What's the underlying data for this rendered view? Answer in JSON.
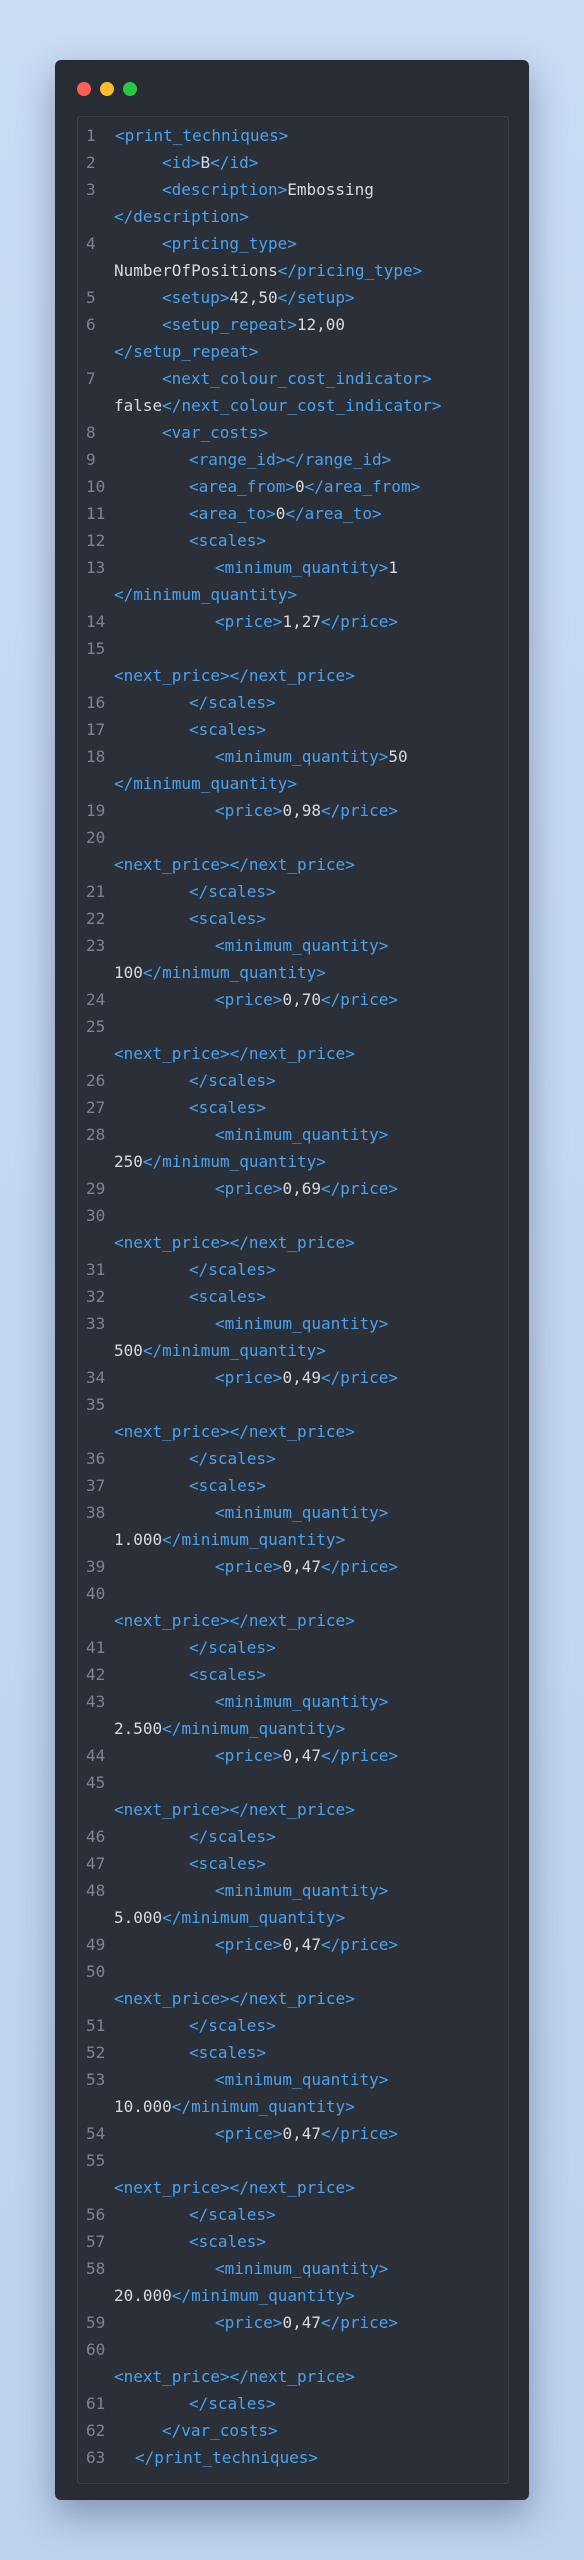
{
  "window": {
    "colors": {
      "red": "#ff5f57",
      "yellow": "#febc2e",
      "green": "#28c840",
      "tag": "#4aa3f0",
      "text": "#d7dae0",
      "line_number": "#7e8590",
      "background": "#282c34"
    }
  },
  "code_lines": [
    {
      "n": "1",
      "indent": 0,
      "parts": [
        [
          "t",
          "<print_techniques>"
        ]
      ]
    },
    {
      "n": "2",
      "indent": 2,
      "parts": [
        [
          "t",
          "<id>"
        ],
        [
          "x",
          "B"
        ],
        [
          "t",
          "</id>"
        ]
      ]
    },
    {
      "n": "3",
      "indent": 2,
      "parts": [
        [
          "t",
          "<description>"
        ],
        [
          "x",
          "Embossing"
        ]
      ],
      "cont": [
        [
          "t",
          "</description>"
        ]
      ]
    },
    {
      "n": "4",
      "indent": 2,
      "parts": [
        [
          "t",
          "<pricing_type>"
        ]
      ],
      "cont": [
        [
          "x",
          "NumberOfPositions"
        ],
        [
          "t",
          "</pricing_type>"
        ]
      ]
    },
    {
      "n": "5",
      "indent": 2,
      "parts": [
        [
          "t",
          "<setup>"
        ],
        [
          "x",
          "42,50"
        ],
        [
          "t",
          "</setup>"
        ]
      ]
    },
    {
      "n": "6",
      "indent": 2,
      "parts": [
        [
          "t",
          "<setup_repeat>"
        ],
        [
          "x",
          "12,00"
        ]
      ],
      "cont": [
        [
          "t",
          "</setup_repeat>"
        ]
      ]
    },
    {
      "n": "7",
      "indent": 2,
      "parts": [
        [
          "t",
          "<next_colour_cost_indicator>"
        ]
      ],
      "cont": [
        [
          "x",
          "false"
        ],
        [
          "t",
          "</next_colour_cost_indicator>"
        ]
      ]
    },
    {
      "n": "8",
      "indent": 2,
      "parts": [
        [
          "t",
          "<var_costs>"
        ]
      ]
    },
    {
      "n": "9",
      "indent": 3,
      "parts": [
        [
          "t",
          "<range_id>"
        ],
        [
          "t",
          "</range_id>"
        ]
      ]
    },
    {
      "n": "10",
      "indent": 3,
      "parts": [
        [
          "t",
          "<area_from>"
        ],
        [
          "x",
          "0"
        ],
        [
          "t",
          "</area_from>"
        ]
      ]
    },
    {
      "n": "11",
      "indent": 3,
      "parts": [
        [
          "t",
          "<area_to>"
        ],
        [
          "x",
          "0"
        ],
        [
          "t",
          "</area_to>"
        ]
      ]
    },
    {
      "n": "12",
      "indent": 3,
      "parts": [
        [
          "t",
          "<scales>"
        ]
      ]
    },
    {
      "n": "13",
      "indent": 4,
      "parts": [
        [
          "t",
          "<minimum_quantity>"
        ],
        [
          "x",
          "1"
        ]
      ],
      "cont": [
        [
          "t",
          "</minimum_quantity>"
        ]
      ]
    },
    {
      "n": "14",
      "indent": 4,
      "parts": [
        [
          "t",
          "<price>"
        ],
        [
          "x",
          "1,27"
        ],
        [
          "t",
          "</price>"
        ]
      ]
    },
    {
      "n": "15",
      "indent": 0,
      "parts": [],
      "cont": [
        [
          "t",
          "<next_price>"
        ],
        [
          "t",
          "</next_price>"
        ]
      ]
    },
    {
      "n": "16",
      "indent": 3,
      "parts": [
        [
          "t",
          "</scales>"
        ]
      ]
    },
    {
      "n": "17",
      "indent": 3,
      "parts": [
        [
          "t",
          "<scales>"
        ]
      ]
    },
    {
      "n": "18",
      "indent": 4,
      "parts": [
        [
          "t",
          "<minimum_quantity>"
        ],
        [
          "x",
          "50"
        ]
      ],
      "cont": [
        [
          "t",
          "</minimum_quantity>"
        ]
      ]
    },
    {
      "n": "19",
      "indent": 4,
      "parts": [
        [
          "t",
          "<price>"
        ],
        [
          "x",
          "0,98"
        ],
        [
          "t",
          "</price>"
        ]
      ]
    },
    {
      "n": "20",
      "indent": 0,
      "parts": [],
      "cont": [
        [
          "t",
          "<next_price>"
        ],
        [
          "t",
          "</next_price>"
        ]
      ]
    },
    {
      "n": "21",
      "indent": 3,
      "parts": [
        [
          "t",
          "</scales>"
        ]
      ]
    },
    {
      "n": "22",
      "indent": 3,
      "parts": [
        [
          "t",
          "<scales>"
        ]
      ]
    },
    {
      "n": "23",
      "indent": 4,
      "parts": [
        [
          "t",
          "<minimum_quantity>"
        ]
      ],
      "cont": [
        [
          "x",
          "100"
        ],
        [
          "t",
          "</minimum_quantity>"
        ]
      ]
    },
    {
      "n": "24",
      "indent": 4,
      "parts": [
        [
          "t",
          "<price>"
        ],
        [
          "x",
          "0,70"
        ],
        [
          "t",
          "</price>"
        ]
      ]
    },
    {
      "n": "25",
      "indent": 0,
      "parts": [],
      "cont": [
        [
          "t",
          "<next_price>"
        ],
        [
          "t",
          "</next_price>"
        ]
      ]
    },
    {
      "n": "26",
      "indent": 3,
      "parts": [
        [
          "t",
          "</scales>"
        ]
      ]
    },
    {
      "n": "27",
      "indent": 3,
      "parts": [
        [
          "t",
          "<scales>"
        ]
      ]
    },
    {
      "n": "28",
      "indent": 4,
      "parts": [
        [
          "t",
          "<minimum_quantity>"
        ]
      ],
      "cont": [
        [
          "x",
          "250"
        ],
        [
          "t",
          "</minimum_quantity>"
        ]
      ]
    },
    {
      "n": "29",
      "indent": 4,
      "parts": [
        [
          "t",
          "<price>"
        ],
        [
          "x",
          "0,69"
        ],
        [
          "t",
          "</price>"
        ]
      ]
    },
    {
      "n": "30",
      "indent": 0,
      "parts": [],
      "cont": [
        [
          "t",
          "<next_price>"
        ],
        [
          "t",
          "</next_price>"
        ]
      ]
    },
    {
      "n": "31",
      "indent": 3,
      "parts": [
        [
          "t",
          "</scales>"
        ]
      ]
    },
    {
      "n": "32",
      "indent": 3,
      "parts": [
        [
          "t",
          "<scales>"
        ]
      ]
    },
    {
      "n": "33",
      "indent": 4,
      "parts": [
        [
          "t",
          "<minimum_quantity>"
        ]
      ],
      "cont": [
        [
          "x",
          "500"
        ],
        [
          "t",
          "</minimum_quantity>"
        ]
      ]
    },
    {
      "n": "34",
      "indent": 4,
      "parts": [
        [
          "t",
          "<price>"
        ],
        [
          "x",
          "0,49"
        ],
        [
          "t",
          "</price>"
        ]
      ]
    },
    {
      "n": "35",
      "indent": 0,
      "parts": [],
      "cont": [
        [
          "t",
          "<next_price>"
        ],
        [
          "t",
          "</next_price>"
        ]
      ]
    },
    {
      "n": "36",
      "indent": 3,
      "parts": [
        [
          "t",
          "</scales>"
        ]
      ]
    },
    {
      "n": "37",
      "indent": 3,
      "parts": [
        [
          "t",
          "<scales>"
        ]
      ]
    },
    {
      "n": "38",
      "indent": 4,
      "parts": [
        [
          "t",
          "<minimum_quantity>"
        ]
      ],
      "cont": [
        [
          "x",
          "1.000"
        ],
        [
          "t",
          "</minimum_quantity>"
        ]
      ]
    },
    {
      "n": "39",
      "indent": 4,
      "parts": [
        [
          "t",
          "<price>"
        ],
        [
          "x",
          "0,47"
        ],
        [
          "t",
          "</price>"
        ]
      ]
    },
    {
      "n": "40",
      "indent": 0,
      "parts": [],
      "cont": [
        [
          "t",
          "<next_price>"
        ],
        [
          "t",
          "</next_price>"
        ]
      ]
    },
    {
      "n": "41",
      "indent": 3,
      "parts": [
        [
          "t",
          "</scales>"
        ]
      ]
    },
    {
      "n": "42",
      "indent": 3,
      "parts": [
        [
          "t",
          "<scales>"
        ]
      ]
    },
    {
      "n": "43",
      "indent": 4,
      "parts": [
        [
          "t",
          "<minimum_quantity>"
        ]
      ],
      "cont": [
        [
          "x",
          "2.500"
        ],
        [
          "t",
          "</minimum_quantity>"
        ]
      ]
    },
    {
      "n": "44",
      "indent": 4,
      "parts": [
        [
          "t",
          "<price>"
        ],
        [
          "x",
          "0,47"
        ],
        [
          "t",
          "</price>"
        ]
      ]
    },
    {
      "n": "45",
      "indent": 0,
      "parts": [],
      "cont": [
        [
          "t",
          "<next_price>"
        ],
        [
          "t",
          "</next_price>"
        ]
      ]
    },
    {
      "n": "46",
      "indent": 3,
      "parts": [
        [
          "t",
          "</scales>"
        ]
      ]
    },
    {
      "n": "47",
      "indent": 3,
      "parts": [
        [
          "t",
          "<scales>"
        ]
      ]
    },
    {
      "n": "48",
      "indent": 4,
      "parts": [
        [
          "t",
          "<minimum_quantity>"
        ]
      ],
      "cont": [
        [
          "x",
          "5.000"
        ],
        [
          "t",
          "</minimum_quantity>"
        ]
      ]
    },
    {
      "n": "49",
      "indent": 4,
      "parts": [
        [
          "t",
          "<price>"
        ],
        [
          "x",
          "0,47"
        ],
        [
          "t",
          "</price>"
        ]
      ]
    },
    {
      "n": "50",
      "indent": 0,
      "parts": [],
      "cont": [
        [
          "t",
          "<next_price>"
        ],
        [
          "t",
          "</next_price>"
        ]
      ]
    },
    {
      "n": "51",
      "indent": 3,
      "parts": [
        [
          "t",
          "</scales>"
        ]
      ]
    },
    {
      "n": "52",
      "indent": 3,
      "parts": [
        [
          "t",
          "<scales>"
        ]
      ]
    },
    {
      "n": "53",
      "indent": 4,
      "parts": [
        [
          "t",
          "<minimum_quantity>"
        ]
      ],
      "cont": [
        [
          "x",
          "10.000"
        ],
        [
          "t",
          "</minimum_quantity>"
        ]
      ]
    },
    {
      "n": "54",
      "indent": 4,
      "parts": [
        [
          "t",
          "<price>"
        ],
        [
          "x",
          "0,47"
        ],
        [
          "t",
          "</price>"
        ]
      ]
    },
    {
      "n": "55",
      "indent": 0,
      "parts": [],
      "cont": [
        [
          "t",
          "<next_price>"
        ],
        [
          "t",
          "</next_price>"
        ]
      ]
    },
    {
      "n": "56",
      "indent": 3,
      "parts": [
        [
          "t",
          "</scales>"
        ]
      ]
    },
    {
      "n": "57",
      "indent": 3,
      "parts": [
        [
          "t",
          "<scales>"
        ]
      ]
    },
    {
      "n": "58",
      "indent": 4,
      "parts": [
        [
          "t",
          "<minimum_quantity>"
        ]
      ],
      "cont": [
        [
          "x",
          "20.000"
        ],
        [
          "t",
          "</minimum_quantity>"
        ]
      ]
    },
    {
      "n": "59",
      "indent": 4,
      "parts": [
        [
          "t",
          "<price>"
        ],
        [
          "x",
          "0,47"
        ],
        [
          "t",
          "</price>"
        ]
      ]
    },
    {
      "n": "60",
      "indent": 0,
      "parts": [],
      "cont": [
        [
          "t",
          "<next_price>"
        ],
        [
          "t",
          "</next_price>"
        ]
      ]
    },
    {
      "n": "61",
      "indent": 3,
      "parts": [
        [
          "t",
          "</scales>"
        ]
      ]
    },
    {
      "n": "62",
      "indent": 2,
      "parts": [
        [
          "t",
          "</var_costs>"
        ]
      ]
    },
    {
      "n": "63",
      "indent": 1,
      "parts": [
        [
          "t",
          "</print_techniques>"
        ]
      ]
    }
  ]
}
